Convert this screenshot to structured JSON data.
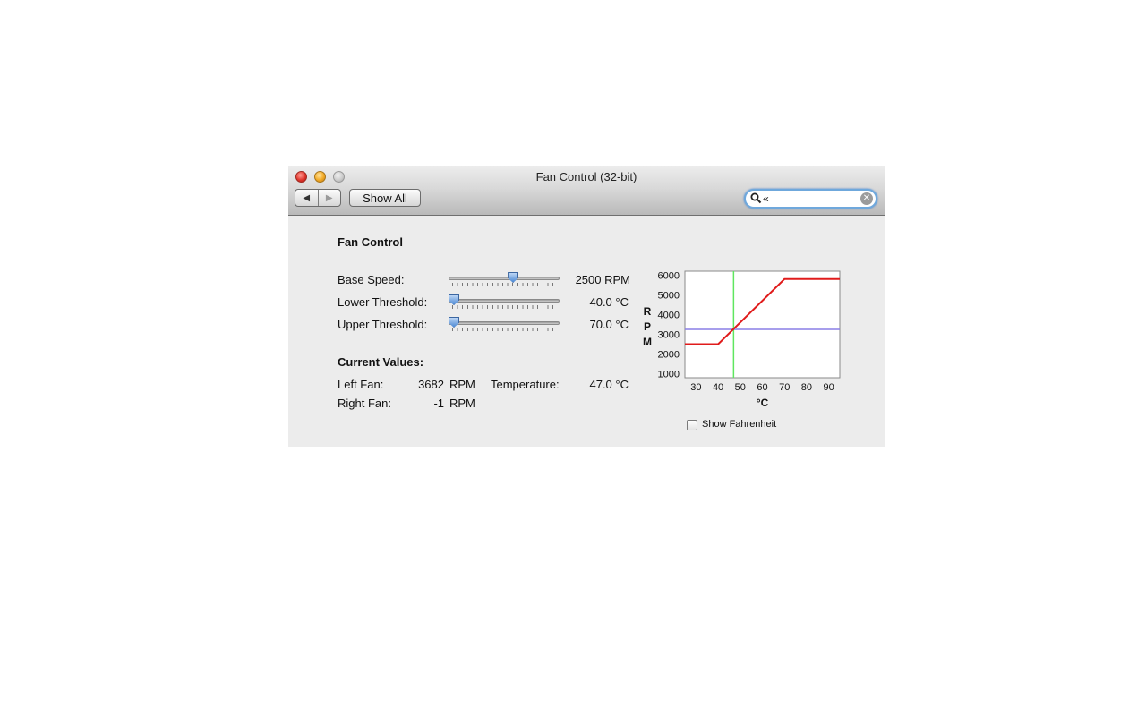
{
  "window": {
    "title": "Fan Control (32-bit)",
    "toolbar": {
      "back": "◀",
      "forward": "▶",
      "show_all": "Show All"
    },
    "search": {
      "value": "«"
    }
  },
  "panel": {
    "title": "Fan Control",
    "sliders": [
      {
        "label": "Base Speed:",
        "value": "2500 RPM",
        "position_fraction": 0.59
      },
      {
        "label": "Lower Threshold:",
        "value": "40.0 °C",
        "position_fraction": 0.0
      },
      {
        "label": "Upper Threshold:",
        "value": "70.0 °C",
        "position_fraction": 0.0
      }
    ],
    "current": {
      "title": "Current Values:",
      "left_fan_label": "Left Fan:",
      "left_fan_value": "3682",
      "left_fan_unit": "RPM",
      "right_fan_label": "Right Fan:",
      "right_fan_value": "-1",
      "right_fan_unit": "RPM",
      "temperature_label": "Temperature:",
      "temperature_value": "47.0 °C"
    },
    "show_fahrenheit": {
      "label": "Show Fahrenheit",
      "checked": false
    }
  },
  "chart_data": {
    "type": "line",
    "xlabel": "°C",
    "ylabel": "RPM",
    "xlim": [
      25,
      95
    ],
    "ylim": [
      800,
      6200
    ],
    "x_ticks": [
      30,
      40,
      50,
      60,
      70,
      80,
      90
    ],
    "y_ticks": [
      1000,
      2000,
      3000,
      4000,
      5000,
      6000
    ],
    "series": [
      {
        "x": [
          25,
          40,
          70,
          95
        ],
        "y": [
          2500,
          2500,
          5800,
          5800
        ],
        "color": "#e01b1b"
      }
    ],
    "hlines": [
      {
        "y": 3250,
        "color": "#8a7fe6"
      }
    ],
    "vlines": [
      {
        "x": 47,
        "color": "#5fe65f"
      }
    ]
  }
}
